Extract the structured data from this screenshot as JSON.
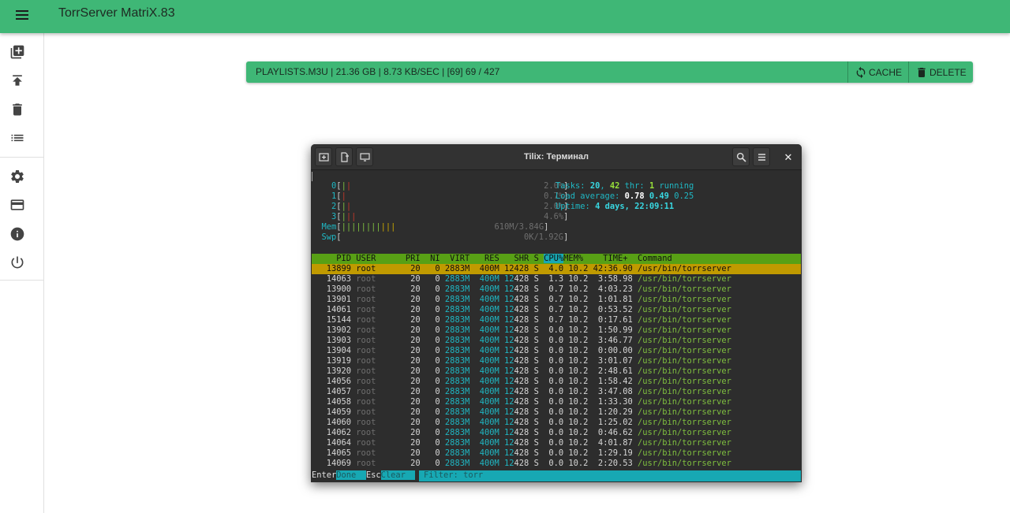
{
  "appbar": {
    "title": "TorrServer MatriX.83"
  },
  "sidebar": {
    "items": [
      {
        "name": "add-torrent",
        "icon": "library-add-icon"
      },
      {
        "name": "upload",
        "icon": "publish-icon"
      },
      {
        "name": "remove-all",
        "icon": "delete-icon"
      },
      {
        "name": "playlist",
        "icon": "list-icon"
      },
      {
        "name": "settings",
        "icon": "gear-icon"
      },
      {
        "name": "donate",
        "icon": "credit-card-icon"
      },
      {
        "name": "about",
        "icon": "info-icon"
      },
      {
        "name": "close-server",
        "icon": "power-icon"
      }
    ]
  },
  "torrent": {
    "title": "PLAYLISTS.M3U | 21.36 GB | 8.73 KB/SEC | [69] 69 / 427",
    "cache_label": "CACHE",
    "delete_label": "DELETE"
  },
  "terminal": {
    "title": "Tilix: Терминал",
    "cpus": [
      {
        "id": "0",
        "pct": "2.0%"
      },
      {
        "id": "1",
        "pct": "0.7%"
      },
      {
        "id": "2",
        "pct": "2.0%"
      },
      {
        "id": "3",
        "pct": "4.6%"
      }
    ],
    "mem_label": "Mem",
    "mem_value": "610M/3.84G",
    "swp_label": "Swp",
    "swp_value": "0K/1.92G",
    "tasks_label": "Tasks:",
    "tasks": "20",
    "thr": "42",
    "thr_label": "thr:",
    "running": "1",
    "running_label": "running",
    "load_label": "Load average:",
    "load1": "0.78",
    "load5": "0.49",
    "load15": "0.25",
    "uptime_label": "Uptime:",
    "uptime": "4 days, 22:09:11",
    "header": {
      "pid": "PID",
      "user": "USER",
      "pri": "PRI",
      "ni": "NI",
      "virt": "VIRT",
      "res": "RES",
      "shr": "SHR",
      "s": "S",
      "cpu": "CPU%",
      "mem": "MEM%",
      "time": "TIME+",
      "command": "Command"
    },
    "processes": [
      {
        "pid": "13899",
        "user": "root",
        "pri": "20",
        "ni": "0",
        "virt": "2883M",
        "res": "400M",
        "shr": "12428",
        "s": "S",
        "cpu": "4.0",
        "mem": "10.2",
        "time": "42:36.90",
        "cmd": "/usr/bin/torrserver"
      },
      {
        "pid": "14063",
        "user": "root",
        "pri": "20",
        "ni": "0",
        "virt": "2883M",
        "res": "400M",
        "shr": "12428",
        "s": "S",
        "cpu": "1.3",
        "mem": "10.2",
        "time": "3:58.98",
        "cmd": "/usr/bin/torrserver"
      },
      {
        "pid": "13900",
        "user": "root",
        "pri": "20",
        "ni": "0",
        "virt": "2883M",
        "res": "400M",
        "shr": "12428",
        "s": "S",
        "cpu": "0.7",
        "mem": "10.2",
        "time": "4:03.23",
        "cmd": "/usr/bin/torrserver"
      },
      {
        "pid": "13901",
        "user": "root",
        "pri": "20",
        "ni": "0",
        "virt": "2883M",
        "res": "400M",
        "shr": "12428",
        "s": "S",
        "cpu": "0.7",
        "mem": "10.2",
        "time": "1:01.81",
        "cmd": "/usr/bin/torrserver"
      },
      {
        "pid": "14061",
        "user": "root",
        "pri": "20",
        "ni": "0",
        "virt": "2883M",
        "res": "400M",
        "shr": "12428",
        "s": "S",
        "cpu": "0.7",
        "mem": "10.2",
        "time": "0:53.52",
        "cmd": "/usr/bin/torrserver"
      },
      {
        "pid": "15144",
        "user": "root",
        "pri": "20",
        "ni": "0",
        "virt": "2883M",
        "res": "400M",
        "shr": "12428",
        "s": "S",
        "cpu": "0.7",
        "mem": "10.2",
        "time": "0:17.61",
        "cmd": "/usr/bin/torrserver"
      },
      {
        "pid": "13902",
        "user": "root",
        "pri": "20",
        "ni": "0",
        "virt": "2883M",
        "res": "400M",
        "shr": "12428",
        "s": "S",
        "cpu": "0.0",
        "mem": "10.2",
        "time": "1:50.99",
        "cmd": "/usr/bin/torrserver"
      },
      {
        "pid": "13903",
        "user": "root",
        "pri": "20",
        "ni": "0",
        "virt": "2883M",
        "res": "400M",
        "shr": "12428",
        "s": "S",
        "cpu": "0.0",
        "mem": "10.2",
        "time": "3:46.77",
        "cmd": "/usr/bin/torrserver"
      },
      {
        "pid": "13904",
        "user": "root",
        "pri": "20",
        "ni": "0",
        "virt": "2883M",
        "res": "400M",
        "shr": "12428",
        "s": "S",
        "cpu": "0.0",
        "mem": "10.2",
        "time": "0:00.00",
        "cmd": "/usr/bin/torrserver"
      },
      {
        "pid": "13919",
        "user": "root",
        "pri": "20",
        "ni": "0",
        "virt": "2883M",
        "res": "400M",
        "shr": "12428",
        "s": "S",
        "cpu": "0.0",
        "mem": "10.2",
        "time": "3:01.07",
        "cmd": "/usr/bin/torrserver"
      },
      {
        "pid": "13920",
        "user": "root",
        "pri": "20",
        "ni": "0",
        "virt": "2883M",
        "res": "400M",
        "shr": "12428",
        "s": "S",
        "cpu": "0.0",
        "mem": "10.2",
        "time": "2:48.61",
        "cmd": "/usr/bin/torrserver"
      },
      {
        "pid": "14056",
        "user": "root",
        "pri": "20",
        "ni": "0",
        "virt": "2883M",
        "res": "400M",
        "shr": "12428",
        "s": "S",
        "cpu": "0.0",
        "mem": "10.2",
        "time": "1:58.42",
        "cmd": "/usr/bin/torrserver"
      },
      {
        "pid": "14057",
        "user": "root",
        "pri": "20",
        "ni": "0",
        "virt": "2883M",
        "res": "400M",
        "shr": "12428",
        "s": "S",
        "cpu": "0.0",
        "mem": "10.2",
        "time": "3:47.08",
        "cmd": "/usr/bin/torrserver"
      },
      {
        "pid": "14058",
        "user": "root",
        "pri": "20",
        "ni": "0",
        "virt": "2883M",
        "res": "400M",
        "shr": "12428",
        "s": "S",
        "cpu": "0.0",
        "mem": "10.2",
        "time": "1:33.30",
        "cmd": "/usr/bin/torrserver"
      },
      {
        "pid": "14059",
        "user": "root",
        "pri": "20",
        "ni": "0",
        "virt": "2883M",
        "res": "400M",
        "shr": "12428",
        "s": "S",
        "cpu": "0.0",
        "mem": "10.2",
        "time": "1:20.29",
        "cmd": "/usr/bin/torrserver"
      },
      {
        "pid": "14060",
        "user": "root",
        "pri": "20",
        "ni": "0",
        "virt": "2883M",
        "res": "400M",
        "shr": "12428",
        "s": "S",
        "cpu": "0.0",
        "mem": "10.2",
        "time": "1:25.02",
        "cmd": "/usr/bin/torrserver"
      },
      {
        "pid": "14062",
        "user": "root",
        "pri": "20",
        "ni": "0",
        "virt": "2883M",
        "res": "400M",
        "shr": "12428",
        "s": "S",
        "cpu": "0.0",
        "mem": "10.2",
        "time": "0:46.62",
        "cmd": "/usr/bin/torrserver"
      },
      {
        "pid": "14064",
        "user": "root",
        "pri": "20",
        "ni": "0",
        "virt": "2883M",
        "res": "400M",
        "shr": "12428",
        "s": "S",
        "cpu": "0.0",
        "mem": "10.2",
        "time": "4:01.87",
        "cmd": "/usr/bin/torrserver"
      },
      {
        "pid": "14065",
        "user": "root",
        "pri": "20",
        "ni": "0",
        "virt": "2883M",
        "res": "400M",
        "shr": "12428",
        "s": "S",
        "cpu": "0.0",
        "mem": "10.2",
        "time": "1:29.19",
        "cmd": "/usr/bin/torrserver"
      },
      {
        "pid": "14069",
        "user": "root",
        "pri": "20",
        "ni": "0",
        "virt": "2883M",
        "res": "400M",
        "shr": "12428",
        "s": "S",
        "cpu": "0.0",
        "mem": "10.2",
        "time": "2:20.53",
        "cmd": "/usr/bin/torrserver"
      }
    ],
    "footer": {
      "enter_key": "Enter",
      "enter_label": "Done",
      "esc_key": "Esc",
      "esc_label": "Clear",
      "filter_label": "Filter:",
      "filter_value": "torr"
    }
  },
  "colors": {
    "accent": "#3fb776",
    "terminal_bg": "#2d2d2d",
    "selection": "#c09a00",
    "header_bg": "#58a015"
  }
}
